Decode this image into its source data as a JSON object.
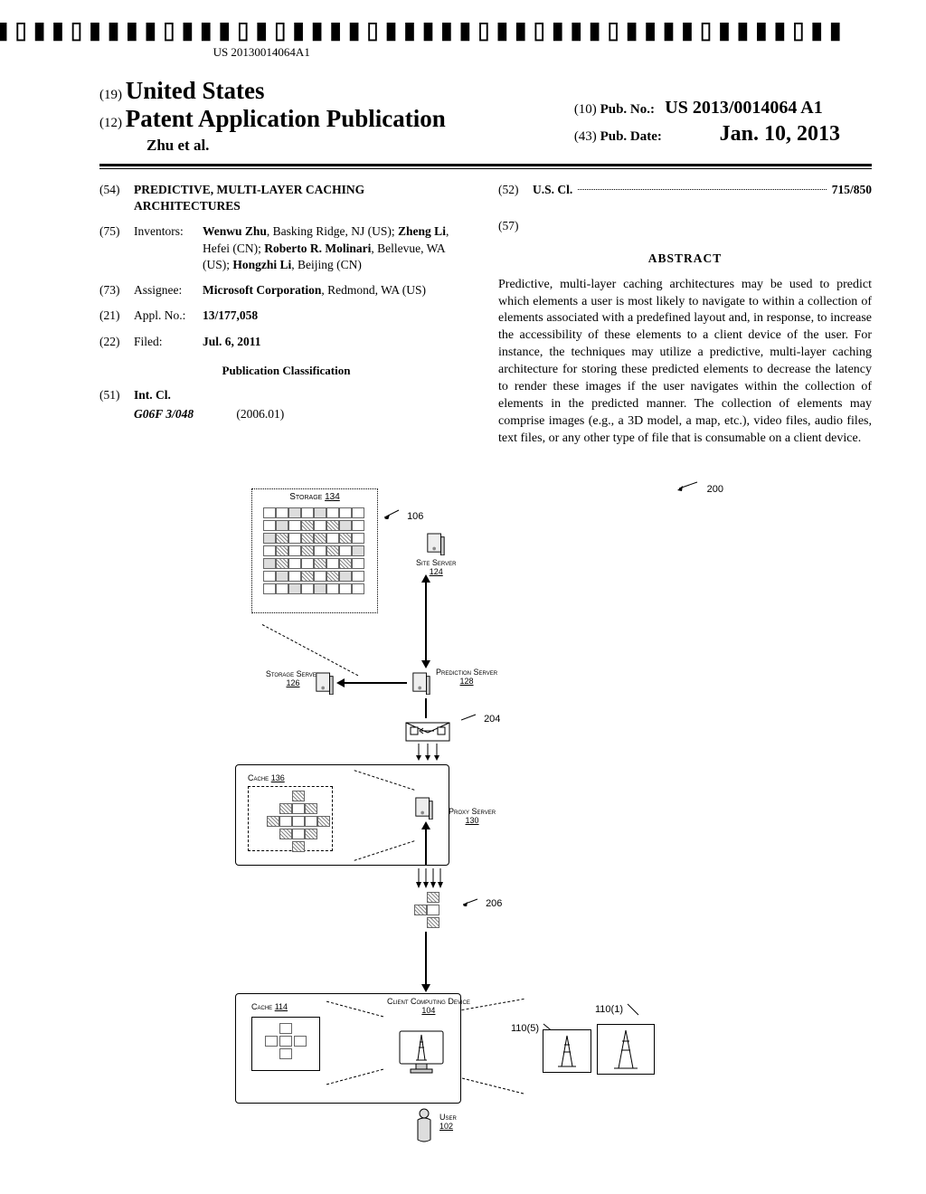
{
  "barcode_number": "US 20130014064A1",
  "header": {
    "code19": "(19)",
    "country": "United States",
    "code12": "(12)",
    "pub_type": "Patent Application Publication",
    "authors_short": "Zhu et al.",
    "code10": "(10)",
    "pubno_label": "Pub. No.:",
    "pubno": "US 2013/0014064 A1",
    "code43": "(43)",
    "pubdate_label": "Pub. Date:",
    "pubdate": "Jan. 10, 2013"
  },
  "left_col": {
    "f54_code": "(54)",
    "f54_title": "PREDICTIVE, MULTI-LAYER CACHING ARCHITECTURES",
    "f75_code": "(75)",
    "f75_label": "Inventors:",
    "f75_body": "Wenwu Zhu, Basking Ridge, NJ (US); Zheng Li, Hefei (CN); Roberto R. Molinari, Bellevue, WA (US); Hongzhi Li, Beijing (CN)",
    "f75_bold_names": [
      "Wenwu Zhu",
      "Zheng Li",
      "Roberto R. Molinari",
      "Hongzhi Li"
    ],
    "f73_code": "(73)",
    "f73_label": "Assignee:",
    "f73_body": "Microsoft Corporation, Redmond, WA (US)",
    "f73_bold": "Microsoft Corporation",
    "f21_code": "(21)",
    "f21_label": "Appl. No.:",
    "f21_body": "13/177,058",
    "f22_code": "(22)",
    "f22_label": "Filed:",
    "f22_body": "Jul. 6, 2011",
    "pubclass_heading": "Publication Classification",
    "f51_code": "(51)",
    "f51_label": "Int. Cl.",
    "f51_class": "G06F 3/048",
    "f51_year": "(2006.01)"
  },
  "right_col": {
    "f52_code": "(52)",
    "f52_label": "U.S. Cl.",
    "f52_val": "715/850",
    "f57_code": "(57)",
    "abstract_heading": "ABSTRACT",
    "abstract": "Predictive, multi-layer caching architectures may be used to predict which elements a user is most likely to navigate to within a collection of elements associated with a predefined layout and, in response, to increase the accessibility of these elements to a client device of the user. For instance, the techniques may utilize a predictive, multi-layer caching architecture for storing these predicted elements to decrease the latency to render these images if the user navigates within the collection of elements in the predicted manner. The collection of elements may comprise images (e.g., a 3D model, a map, etc.), video files, audio files, text files, or any other type of file that is consumable on a client device."
  },
  "figure": {
    "ref200": "200",
    "storage134_label": "Storage",
    "storage134_num": "134",
    "ref106": "106",
    "site_server_label": "Site Server",
    "site_server_num": "124",
    "storage_server_label": "Storage Server",
    "storage_server_num": "126",
    "prediction_server_label": "Prediction Server",
    "prediction_server_num": "128",
    "ref204": "204",
    "cache136_label": "Cache",
    "cache136_num": "136",
    "proxy_server_label": "Proxy Server",
    "proxy_server_num": "130",
    "ref206": "206",
    "cache114_label": "Cache",
    "cache114_num": "114",
    "client_label": "Client Computing Device",
    "client_num": "104",
    "user_label": "User",
    "user_num": "102",
    "ref110_1": "110(1)",
    "ref110_5": "110(5)"
  }
}
